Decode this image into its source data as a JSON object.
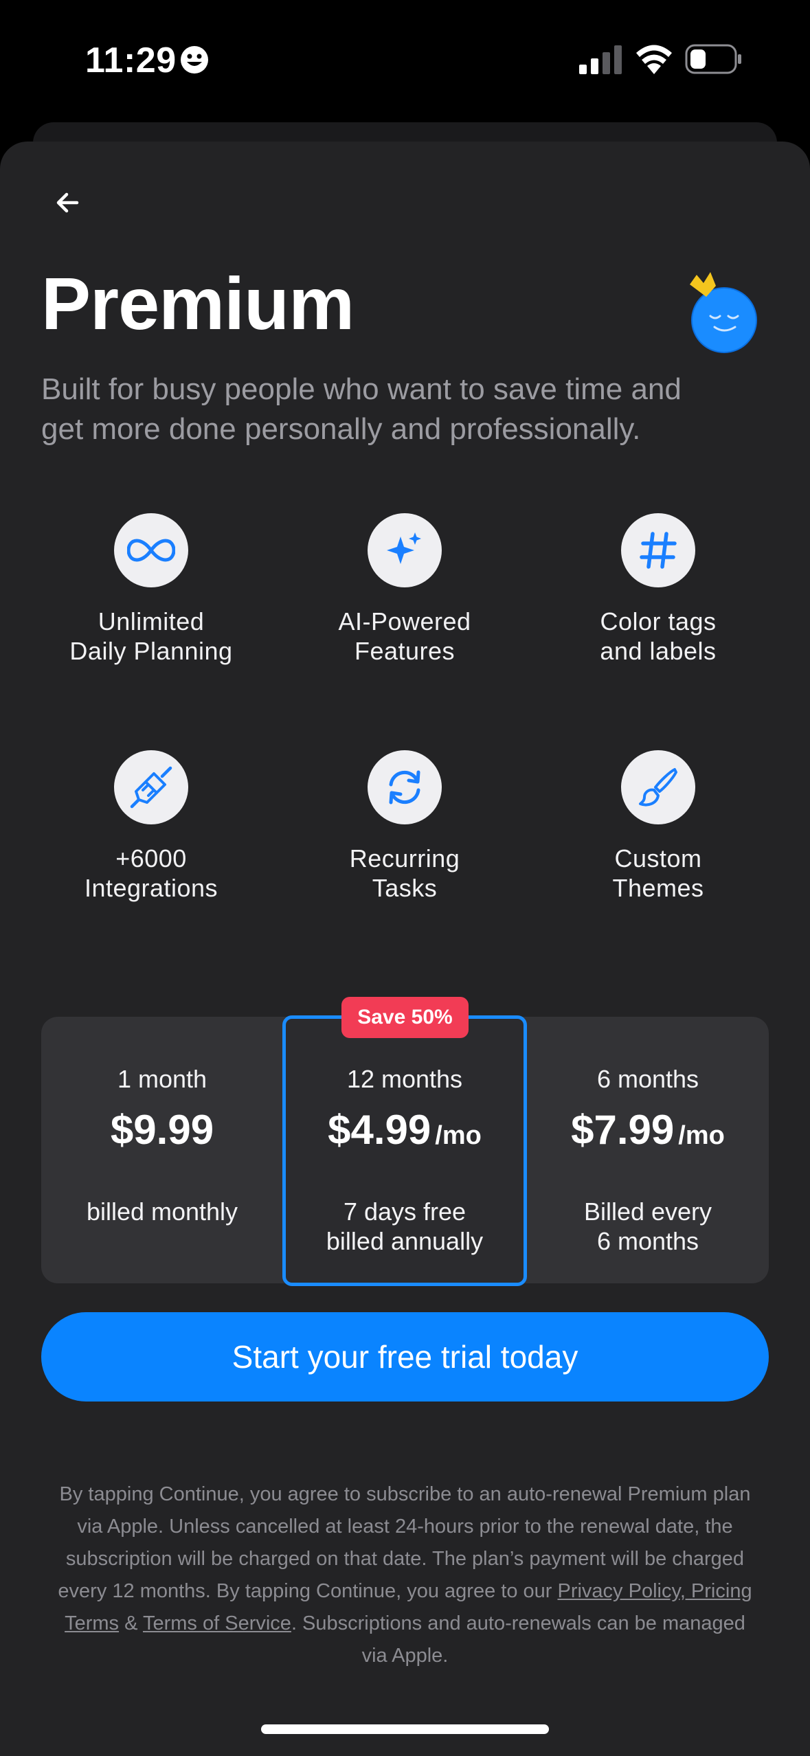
{
  "status_bar": {
    "time": "11:29"
  },
  "header": {
    "title": "Premium",
    "subtitle_line1": "Built for busy people who want to save time and",
    "subtitle_line2": "get more done personally and professionally."
  },
  "features": [
    {
      "icon": "infinity-icon",
      "line1": "Unlimited",
      "line2": "Daily Planning"
    },
    {
      "icon": "sparkles-icon",
      "line1": "AI-Powered",
      "line2": "Features"
    },
    {
      "icon": "hashtag-icon",
      "line1": "Color tags",
      "line2": "and labels"
    },
    {
      "icon": "plug-icon",
      "line1": "+6000",
      "line2": "Integrations"
    },
    {
      "icon": "refresh-icon",
      "line1": "Recurring",
      "line2": "Tasks"
    },
    {
      "icon": "paintbrush-icon",
      "line1": "Custom",
      "line2": "Themes"
    }
  ],
  "plans": [
    {
      "period": "1 month",
      "price": "$9.99",
      "per": "",
      "billing_line1": "billed monthly",
      "billing_line2": ""
    },
    {
      "period": "12 months",
      "price": "$4.99",
      "per": "/mo",
      "billing_line1": "7 days free",
      "billing_line2": "billed annually",
      "badge": "Save 50%",
      "selected": true
    },
    {
      "period": "6 months",
      "price": "$7.99",
      "per": "/mo",
      "billing_line1": "Billed every",
      "billing_line2": "6 months"
    }
  ],
  "cta": {
    "label": "Start your free trial today"
  },
  "legal": {
    "line1": "By tapping Continue, you agree to subscribe to an auto-renewal Premium plan",
    "line2": "via Apple. Unless cancelled at least 24-hours prior to the renewal date, the",
    "line3": "subscription will be charged on that date. The plan’s payment will be charged",
    "line4_prefix": "every 12 months. By tapping Continue, you agree to our ",
    "link_privacy": "Privacy Policy, Pricing",
    "link_pricing_terms": "Terms",
    "amp": " & ",
    "link_tos": "Terms of Service",
    "line5_suffix": ". Subscriptions and auto-renewals can be managed",
    "line6": "via Apple."
  },
  "colors": {
    "accent": "#0a84ff",
    "badge": "#f23c55",
    "sheet": "#232325"
  }
}
